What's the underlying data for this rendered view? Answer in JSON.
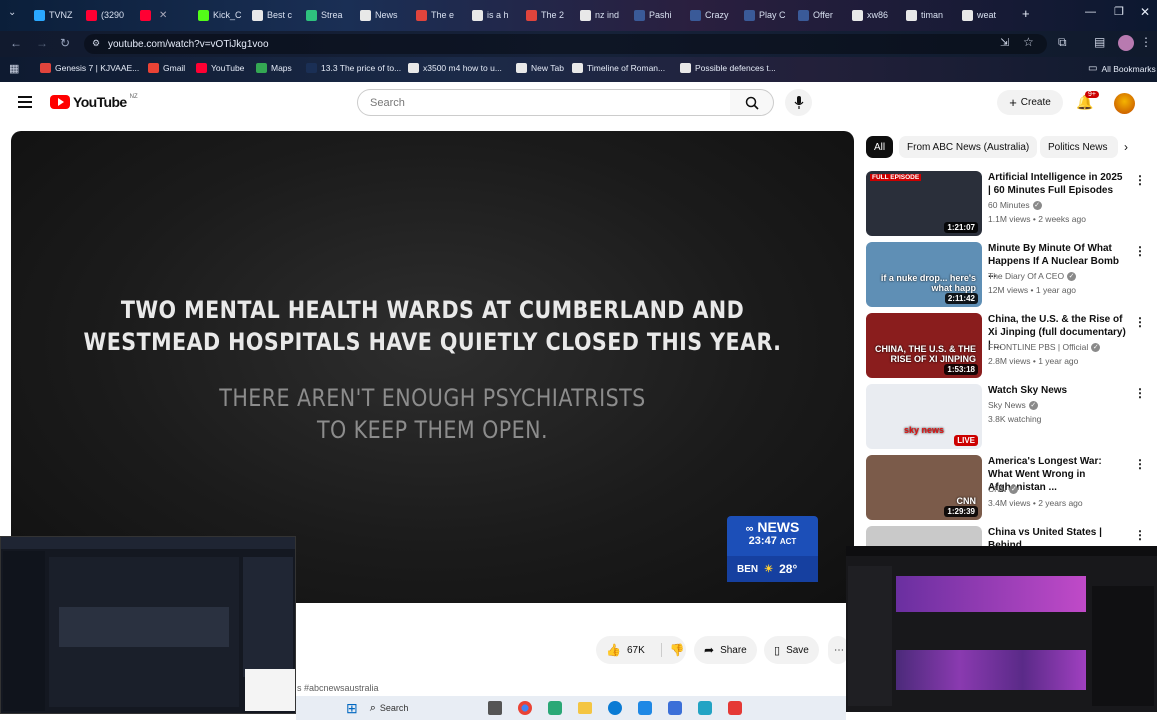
{
  "browser": {
    "tabs": [
      {
        "label": "TVNZ",
        "color": "#2aa8ff"
      },
      {
        "label": "(3290",
        "color": "#ff0033"
      },
      {
        "label": "",
        "color": "#ff0033"
      },
      {
        "label": "Kick_C",
        "color": "#53fc18"
      },
      {
        "label": "Best c",
        "color": "#e8e8e8"
      },
      {
        "label": "Strea",
        "color": "#2ec27e"
      },
      {
        "label": "News",
        "color": "#e8e8e8"
      },
      {
        "label": "The e",
        "color": "#e0443c"
      },
      {
        "label": "is a h",
        "color": "#e8e8e8"
      },
      {
        "label": "The 2",
        "color": "#e0443c"
      },
      {
        "label": "nz ind",
        "color": "#e8e8e8"
      },
      {
        "label": "Pashi",
        "color": "#3a5a98"
      },
      {
        "label": "Crazy",
        "color": "#3a5a98"
      },
      {
        "label": "Play C",
        "color": "#3a5a98"
      },
      {
        "label": "Offer",
        "color": "#3a5a98"
      },
      {
        "label": "xw86",
        "color": "#e8e8e8"
      },
      {
        "label": "timan",
        "color": "#e8e8e8"
      },
      {
        "label": "weat",
        "color": "#e8e8e8"
      }
    ],
    "url": "youtube.com/watch?v=vOTiJkg1voo",
    "bookmarks": [
      {
        "label": "Genesis 7 | KJVAAE...",
        "color": "#e0443c"
      },
      {
        "label": "Gmail",
        "color": "#ea4335"
      },
      {
        "label": "YouTube",
        "color": "#ff0033"
      },
      {
        "label": "Maps",
        "color": "#34a853"
      },
      {
        "label": "13.3 The price of to...",
        "color": "#1a2f55"
      },
      {
        "label": "x3500 m4 how to u...",
        "color": "#e8e8e8"
      },
      {
        "label": "New Tab",
        "color": "#e8e8e8"
      },
      {
        "label": "Timeline of Roman...",
        "color": "#e8e8e8"
      },
      {
        "label": "Possible defences t...",
        "color": "#e8e8e8"
      }
    ],
    "all_bookmarks": "All Bookmarks"
  },
  "youtube": {
    "logo_text": "YouTube",
    "region": "NZ",
    "search_placeholder": "Search",
    "create_label": "Create",
    "notifications": "9+"
  },
  "player": {
    "caption_line1": "TWO MENTAL HEALTH WARDS AT CUMBERLAND AND",
    "caption_line2": "WESTMEAD HOSPITALS HAVE QUIETLY CLOSED THIS YEAR.",
    "caption_line3": "THERE AREN'T ENOUGH PSYCHIATRISTS",
    "caption_line4": "TO KEEP THEM OPEN.",
    "bug_brand": "NEWS",
    "bug_time": "23:47",
    "bug_tz": "ACT",
    "bug_city": "BEN",
    "bug_temp": "28°"
  },
  "actions": {
    "likes": "67K",
    "share": "Share",
    "save": "Save"
  },
  "hashtag": "s #abcnewsaustralia",
  "chips": [
    "All",
    "From ABC News (Australia)",
    "Politics News"
  ],
  "videos": [
    {
      "title": "Artificial Intelligence in 2025 | 60 Minutes Full Episodes",
      "channel": "60 Minutes",
      "meta": "1.1M views • 2 weeks ago",
      "duration": "1:21:07",
      "badge": "FULL EPISODE",
      "thumb_color": "#2a2f3a"
    },
    {
      "title": "Minute By Minute Of What Happens If A Nuclear Bomb ...",
      "channel": "The Diary Of A CEO",
      "meta": "12M views • 1 year ago",
      "duration": "2:11:42",
      "badge": "",
      "thumb_color": "#5f8fb5",
      "overlay": "if a nuke drop... here's what happ"
    },
    {
      "title": "China, the U.S. & the Rise of Xi Jinping (full documentary) | ...",
      "channel": "FRONTLINE PBS | Official",
      "meta": "2.8M views • 1 year ago",
      "duration": "1:53:18",
      "badge": "",
      "thumb_color": "#8a1d1d",
      "overlay": "CHINA, THE U.S. & THE RISE OF XI JINPING"
    },
    {
      "title": "Watch Sky News",
      "channel": "Sky News",
      "meta": "3.8K watching",
      "duration": "LIVE",
      "badge": "",
      "thumb_color": "#e9ecf1",
      "overlay": "sky news"
    },
    {
      "title": "America's Longest War: What Went Wrong in Afghanistan ...",
      "channel": "CNN",
      "meta": "3.4M views • 2 years ago",
      "duration": "1:29:39",
      "badge": "",
      "thumb_color": "#7b5b4a",
      "overlay": "CNN"
    },
    {
      "title": "China vs United States | Behind",
      "channel": "",
      "meta": "",
      "duration": "",
      "badge": "",
      "thumb_color": "#c9c9c9"
    }
  ],
  "taskbar": {
    "search_label": "Search"
  }
}
